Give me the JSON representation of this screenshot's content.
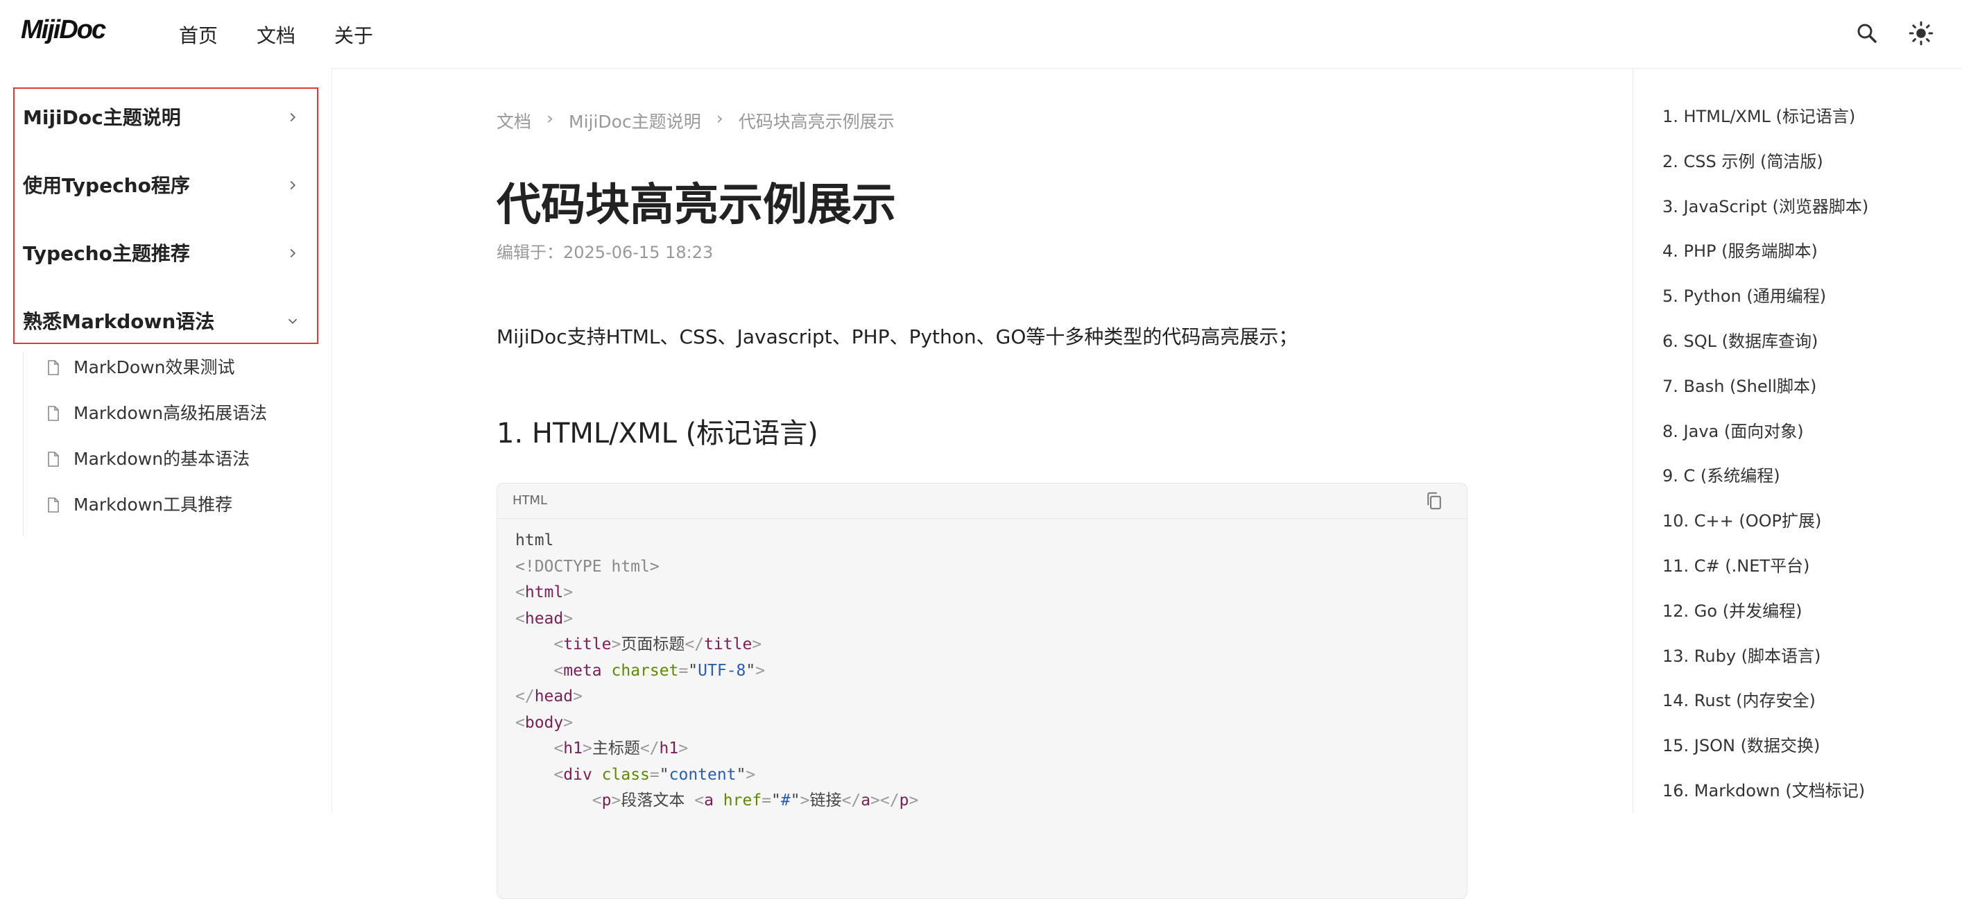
{
  "header": {
    "logo": "MijiDoc",
    "nav": [
      "首页",
      "文档",
      "关于"
    ],
    "icons": [
      "search-icon",
      "theme-toggle-icon"
    ]
  },
  "sidebar": {
    "categories": [
      {
        "label": "MijiDoc主题说明",
        "expanded": false
      },
      {
        "label": "使用Typecho程序",
        "expanded": false
      },
      {
        "label": "Typecho主题推荐",
        "expanded": false
      },
      {
        "label": "熟悉Markdown语法",
        "expanded": true
      }
    ],
    "sub_items": [
      "MarkDown效果测试",
      "Markdown高级拓展语法",
      "Markdown的基本语法",
      "Markdown工具推荐"
    ]
  },
  "main": {
    "breadcrumb": [
      "文档",
      "MijiDoc主题说明",
      "代码块高亮示例展示"
    ],
    "title": "代码块高亮示例展示",
    "edited": "编辑于：2025-06-15 18:23",
    "intro": "MijiDoc支持HTML、CSS、Javascript、PHP、Python、GO等十多种类型的代码高亮展示；",
    "section_title": "1. HTML/XML (标记语言)",
    "code": {
      "language": "HTML",
      "lines": [
        "html",
        "<!DOCTYPE html>",
        "<html>",
        "<head>",
        "    <title>页面标题</title>",
        "    <meta charset=\"UTF-8\">",
        "</head>",
        "<body>",
        "    <h1>主标题</h1>",
        "    <div class=\"content\">",
        "        <p>段落文本 <a href=\"#\">链接</a></p>"
      ]
    }
  },
  "toc": [
    "1. HTML/XML (标记语言)",
    "2. CSS 示例 (简洁版)",
    "3. JavaScript (浏览器脚本)",
    "4. PHP (服务端脚本)",
    "5. Python (通用编程)",
    "6. SQL (数据库查询)",
    "7. Bash (Shell脚本)",
    "8. Java (面向对象)",
    "9. C (系统编程)",
    "10. C++ (OOP扩展)",
    "11. C# (.NET平台)",
    "12. Go (并发编程)",
    "13. Ruby (脚本语言)",
    "14. Rust (内存安全)",
    "15. JSON (数据交换)",
    "16. Markdown (文档标记)"
  ]
}
